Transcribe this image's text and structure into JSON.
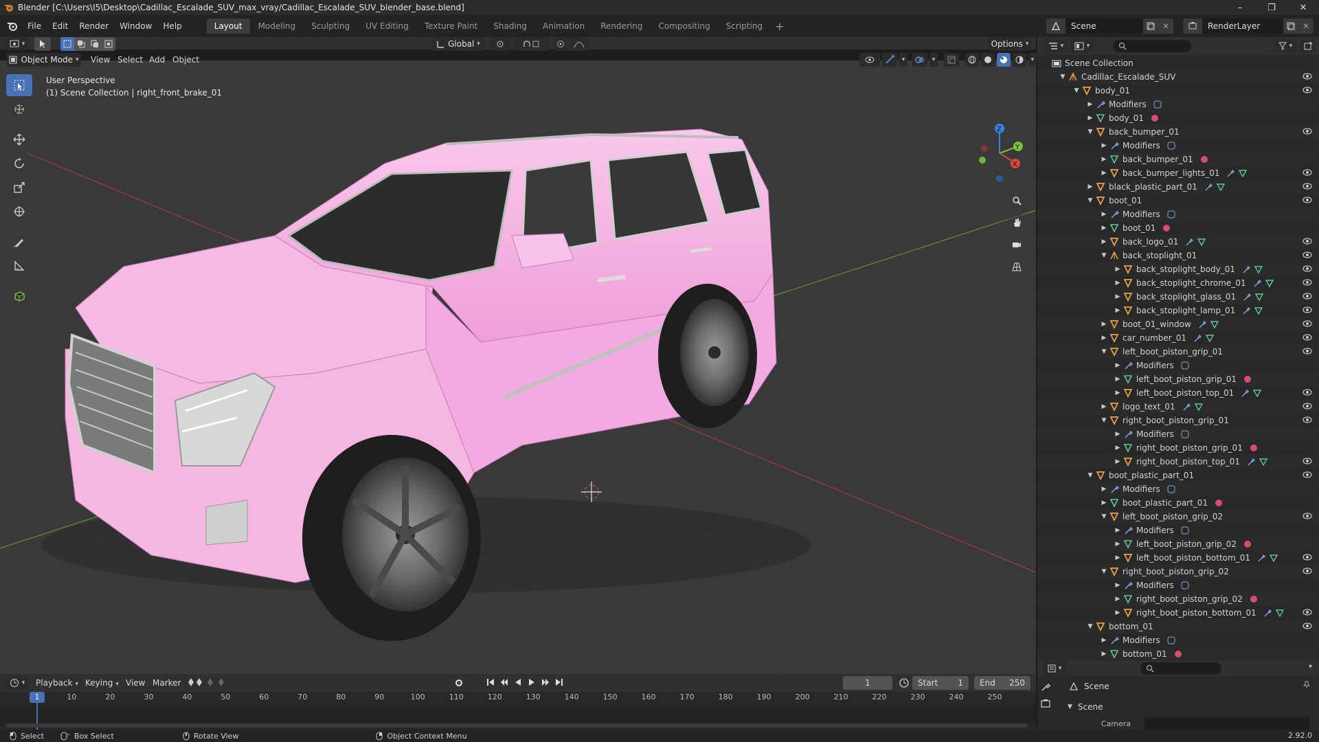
{
  "window": {
    "title": "Blender [C:\\Users\\I5\\Desktop\\Cadillac_Escalade_SUV_max_vray/Cadillac_Escalade_SUV_blender_base.blend]",
    "icon": "blender-logo-icon"
  },
  "menu": {
    "file": "File",
    "edit": "Edit",
    "render": "Render",
    "window": "Window",
    "help": "Help"
  },
  "workspaces": [
    "Layout",
    "Modeling",
    "Sculpting",
    "UV Editing",
    "Texture Paint",
    "Shading",
    "Animation",
    "Rendering",
    "Compositing",
    "Scripting"
  ],
  "active_workspace": "Layout",
  "scene_selector": {
    "label": "Scene"
  },
  "view_layer_selector": {
    "label": "RenderLayer"
  },
  "viewport_header": {
    "mode": "Object Mode",
    "view": "View",
    "select": "Select",
    "add": "Add",
    "object": "Object",
    "transform_orientation": "Global",
    "options": "Options"
  },
  "viewport": {
    "perspective_label": "User Perspective",
    "collection_label": "(1) Scene Collection | right_front_brake_01",
    "car_color": "#f2a9de",
    "axis_x_color": "#e2463b",
    "axis_y_color": "#7ac33f",
    "axis_z_color": "#3a82e0"
  },
  "outliner": {
    "root": "Scene Collection",
    "rows": [
      {
        "depth": 0,
        "expanded": true,
        "icon": "empty-icon",
        "label": "Cadillac_Escalade_SUV",
        "eye": true,
        "extras": []
      },
      {
        "depth": 1,
        "expanded": true,
        "icon": "object-icon",
        "label": "body_01",
        "eye": true,
        "extras": []
      },
      {
        "depth": 2,
        "expanded": false,
        "icon": "modifier-icon",
        "label": "Modifiers",
        "eye": false,
        "extras": [
          "modifier-box"
        ]
      },
      {
        "depth": 2,
        "expanded": false,
        "icon": "mesh-icon",
        "label": "body_01",
        "eye": false,
        "extras": [
          "material"
        ]
      },
      {
        "depth": 2,
        "expanded": true,
        "icon": "object-icon",
        "label": "back_bumper_01",
        "eye": true,
        "extras": []
      },
      {
        "depth": 3,
        "expanded": false,
        "icon": "modifier-icon",
        "label": "Modifiers",
        "eye": false,
        "extras": [
          "modifier-box"
        ]
      },
      {
        "depth": 3,
        "expanded": false,
        "icon": "mesh-icon",
        "label": "back_bumper_01",
        "eye": false,
        "extras": [
          "material"
        ]
      },
      {
        "depth": 3,
        "expanded": false,
        "icon": "object-icon",
        "label": "back_bumper_lights_01",
        "eye": true,
        "extras": [
          "wrench",
          "mesh"
        ]
      },
      {
        "depth": 2,
        "expanded": false,
        "icon": "object-icon",
        "label": "black_plastic_part_01",
        "eye": true,
        "extras": [
          "wrench",
          "mesh"
        ]
      },
      {
        "depth": 2,
        "expanded": true,
        "icon": "object-icon",
        "label": "boot_01",
        "eye": true,
        "extras": []
      },
      {
        "depth": 3,
        "expanded": false,
        "icon": "modifier-icon",
        "label": "Modifiers",
        "eye": false,
        "extras": [
          "modifier-box"
        ]
      },
      {
        "depth": 3,
        "expanded": false,
        "icon": "mesh-icon",
        "label": "boot_01",
        "eye": false,
        "extras": [
          "material"
        ]
      },
      {
        "depth": 3,
        "expanded": false,
        "icon": "object-icon",
        "label": "back_logo_01",
        "eye": true,
        "extras": [
          "wrench",
          "mesh"
        ]
      },
      {
        "depth": 3,
        "expanded": true,
        "icon": "empty-icon",
        "label": "back_stoplight_01",
        "eye": true,
        "extras": []
      },
      {
        "depth": 4,
        "expanded": false,
        "icon": "object-icon",
        "label": "back_stoplight_body_01",
        "eye": true,
        "extras": [
          "wrench",
          "mesh"
        ]
      },
      {
        "depth": 4,
        "expanded": false,
        "icon": "object-icon",
        "label": "back_stoplight_chrome_01",
        "eye": true,
        "extras": [
          "wrench",
          "mesh"
        ]
      },
      {
        "depth": 4,
        "expanded": false,
        "icon": "object-icon",
        "label": "back_stoplight_glass_01",
        "eye": true,
        "extras": [
          "wrench",
          "mesh"
        ]
      },
      {
        "depth": 4,
        "expanded": false,
        "icon": "object-icon",
        "label": "back_stoplight_lamp_01",
        "eye": true,
        "extras": [
          "wrench",
          "mesh"
        ]
      },
      {
        "depth": 3,
        "expanded": false,
        "icon": "object-icon",
        "label": "boot_01_window",
        "eye": true,
        "extras": [
          "wrench",
          "mesh"
        ]
      },
      {
        "depth": 3,
        "expanded": false,
        "icon": "object-icon",
        "label": "car_number_01",
        "eye": true,
        "extras": [
          "wrench",
          "mesh"
        ]
      },
      {
        "depth": 3,
        "expanded": true,
        "icon": "object-icon",
        "label": "left_boot_piston_grip_01",
        "eye": true,
        "extras": []
      },
      {
        "depth": 4,
        "expanded": false,
        "icon": "modifier-icon",
        "label": "Modifiers",
        "eye": false,
        "extras": [
          "modifier-box"
        ]
      },
      {
        "depth": 4,
        "expanded": false,
        "icon": "mesh-icon",
        "label": "left_boot_piston_grip_01",
        "eye": false,
        "extras": [
          "material"
        ]
      },
      {
        "depth": 4,
        "expanded": false,
        "icon": "object-icon",
        "label": "left_boot_piston_top_01",
        "eye": true,
        "extras": [
          "wrench",
          "mesh"
        ]
      },
      {
        "depth": 3,
        "expanded": false,
        "icon": "object-icon",
        "label": "logo_text_01",
        "eye": true,
        "extras": [
          "wrench",
          "mesh"
        ]
      },
      {
        "depth": 3,
        "expanded": true,
        "icon": "object-icon",
        "label": "right_boot_piston_grip_01",
        "eye": true,
        "extras": []
      },
      {
        "depth": 4,
        "expanded": false,
        "icon": "modifier-icon",
        "label": "Modifiers",
        "eye": false,
        "extras": [
          "modifier-box"
        ]
      },
      {
        "depth": 4,
        "expanded": false,
        "icon": "mesh-icon",
        "label": "right_boot_piston_grip_01",
        "eye": false,
        "extras": [
          "material"
        ]
      },
      {
        "depth": 4,
        "expanded": false,
        "icon": "object-icon",
        "label": "right_boot_piston_top_01",
        "eye": true,
        "extras": [
          "wrench",
          "mesh"
        ]
      },
      {
        "depth": 2,
        "expanded": true,
        "icon": "object-icon",
        "label": "boot_plastic_part_01",
        "eye": true,
        "extras": []
      },
      {
        "depth": 3,
        "expanded": false,
        "icon": "modifier-icon",
        "label": "Modifiers",
        "eye": false,
        "extras": [
          "modifier-box"
        ]
      },
      {
        "depth": 3,
        "expanded": false,
        "icon": "mesh-icon",
        "label": "boot_plastic_part_01",
        "eye": false,
        "extras": [
          "material"
        ]
      },
      {
        "depth": 3,
        "expanded": true,
        "icon": "object-icon",
        "label": "left_boot_piston_grip_02",
        "eye": true,
        "extras": []
      },
      {
        "depth": 4,
        "expanded": false,
        "icon": "modifier-icon",
        "label": "Modifiers",
        "eye": false,
        "extras": [
          "modifier-box"
        ]
      },
      {
        "depth": 4,
        "expanded": false,
        "icon": "mesh-icon",
        "label": "left_boot_piston_grip_02",
        "eye": false,
        "extras": [
          "material"
        ]
      },
      {
        "depth": 4,
        "expanded": false,
        "icon": "object-icon",
        "label": "left_boot_piston_bottom_01",
        "eye": true,
        "extras": [
          "wrench",
          "mesh"
        ]
      },
      {
        "depth": 3,
        "expanded": true,
        "icon": "object-icon",
        "label": "right_boot_piston_grip_02",
        "eye": true,
        "extras": []
      },
      {
        "depth": 4,
        "expanded": false,
        "icon": "modifier-icon",
        "label": "Modifiers",
        "eye": false,
        "extras": [
          "modifier-box"
        ]
      },
      {
        "depth": 4,
        "expanded": false,
        "icon": "mesh-icon",
        "label": "right_boot_piston_grip_02",
        "eye": false,
        "extras": [
          "material"
        ]
      },
      {
        "depth": 4,
        "expanded": false,
        "icon": "object-icon",
        "label": "right_boot_piston_bottom_01",
        "eye": true,
        "extras": [
          "wrench",
          "mesh"
        ]
      },
      {
        "depth": 2,
        "expanded": true,
        "icon": "object-icon",
        "label": "bottom_01",
        "eye": true,
        "extras": []
      },
      {
        "depth": 3,
        "expanded": false,
        "icon": "modifier-icon",
        "label": "Modifiers",
        "eye": false,
        "extras": [
          "modifier-box"
        ]
      },
      {
        "depth": 3,
        "expanded": false,
        "icon": "mesh-icon",
        "label": "bottom_01",
        "eye": false,
        "extras": [
          "material"
        ]
      }
    ]
  },
  "properties": {
    "scene_title": "Scene",
    "panel_title": "Scene",
    "camera_label": "Camera"
  },
  "timeline": {
    "playback": "Playback",
    "keying": "Keying",
    "view": "View",
    "marker": "Marker",
    "current_frame": "1",
    "start_label": "Start",
    "start": "1",
    "end_label": "End",
    "end": "250",
    "ticks": [
      "1",
      "10",
      "20",
      "30",
      "40",
      "50",
      "60",
      "70",
      "80",
      "90",
      "100",
      "110",
      "120",
      "130",
      "140",
      "150",
      "160",
      "170",
      "180",
      "190",
      "200",
      "210",
      "220",
      "230",
      "240",
      "250"
    ]
  },
  "statusbar": {
    "select": "Select",
    "box_select": "Box Select",
    "rotate_view": "Rotate View",
    "context_menu": "Object Context Menu",
    "version": "2.92.0"
  }
}
